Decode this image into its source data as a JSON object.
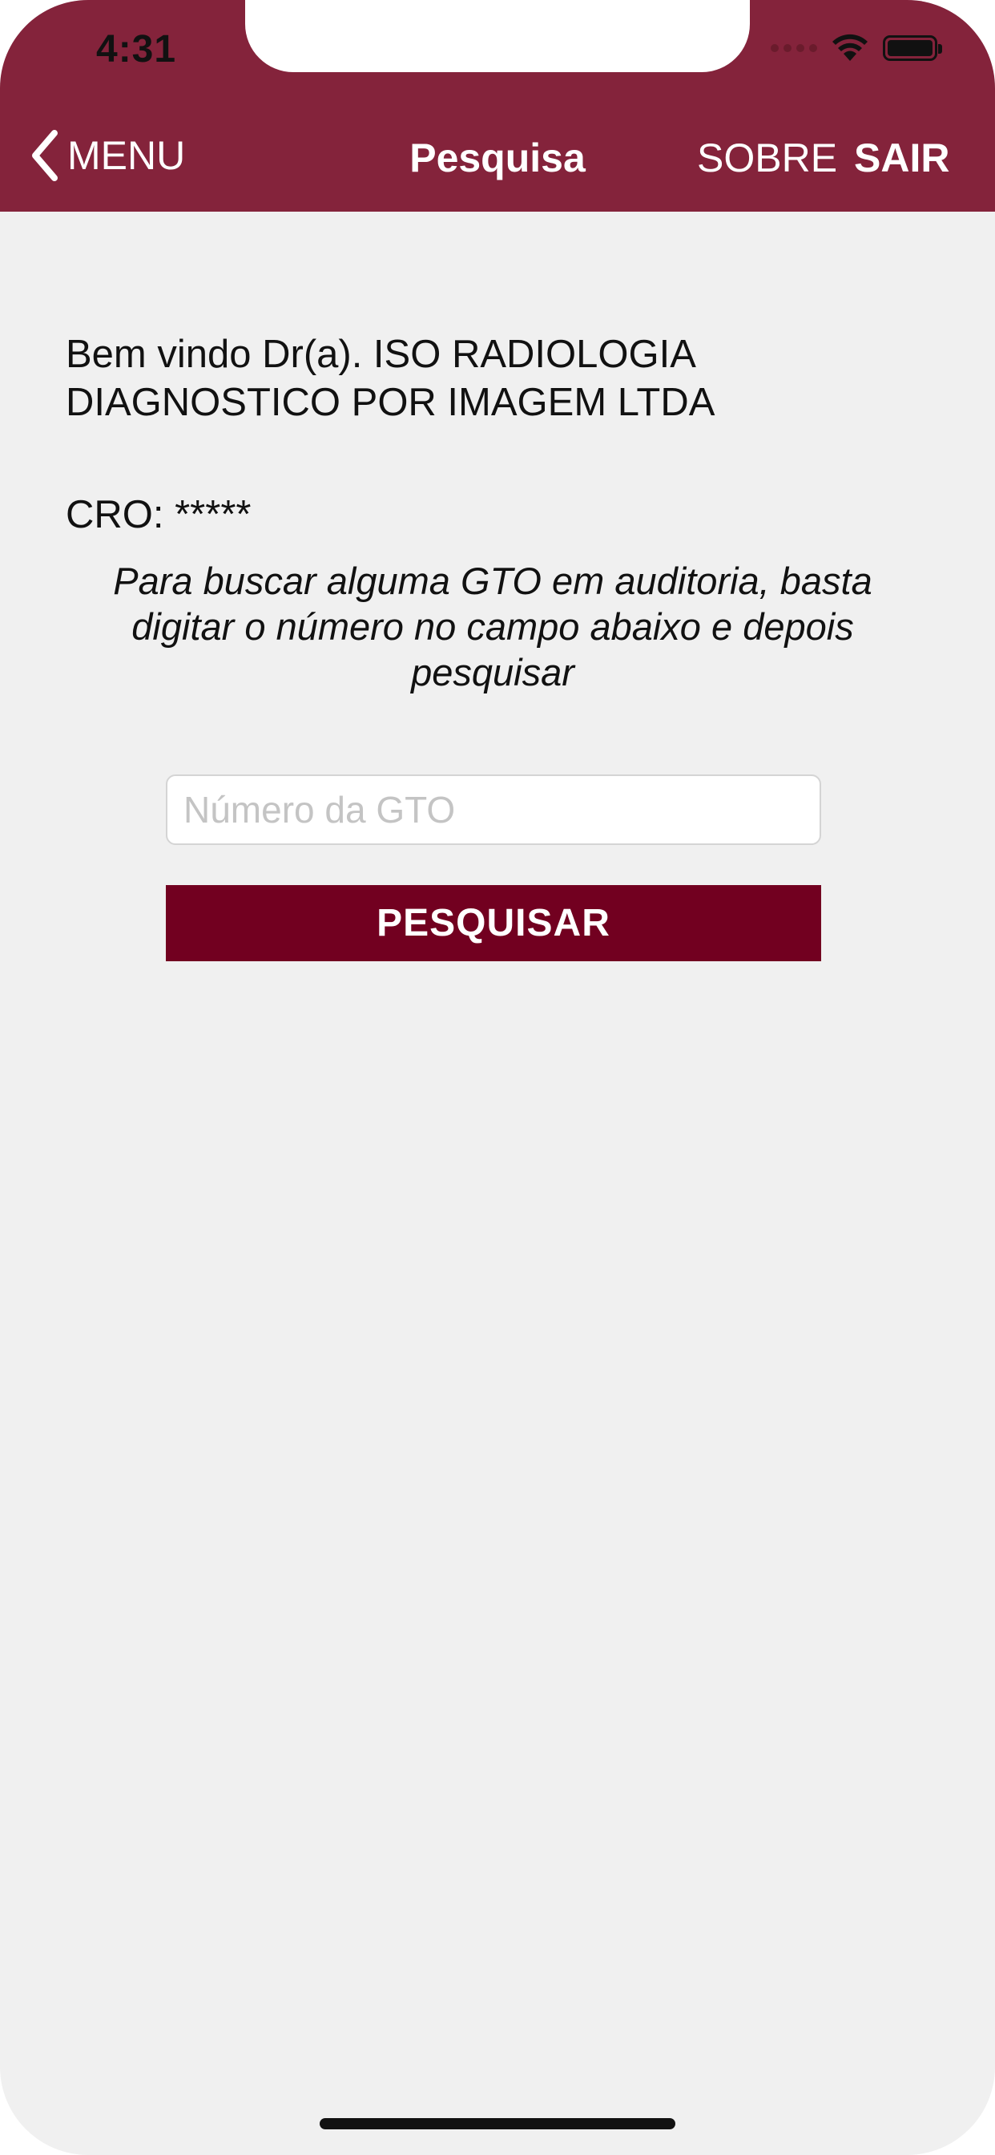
{
  "status_bar": {
    "time": "4:31"
  },
  "nav": {
    "back_label": "MENU",
    "title": "Pesquisa",
    "about_label": "SOBRE",
    "logout_label": "SAIR"
  },
  "content": {
    "welcome": "Bem vindo Dr(a). ISO RADIOLOGIA DIAGNOSTICO POR IMAGEM LTDA",
    "cro": "CRO: *****",
    "instructions": "Para buscar alguma GTO em auditoria, basta digitar o número no campo abaixo e depois pesquisar"
  },
  "search": {
    "input_value": "",
    "placeholder": "Número da GTO",
    "button_label": "PESQUISAR"
  },
  "colors": {
    "header": "#84233b",
    "button": "#720020",
    "background": "#f0f0f0"
  }
}
